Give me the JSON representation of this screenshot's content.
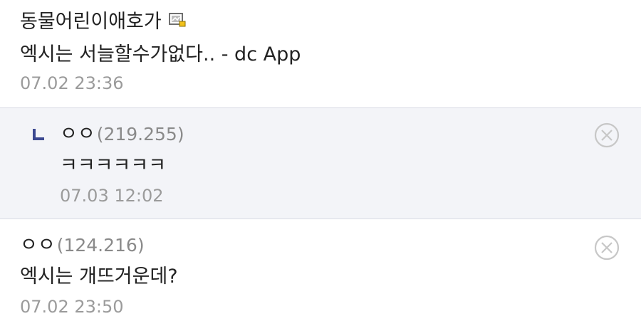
{
  "post_comment": {
    "author": "동물어린이애호가",
    "text": "엑시는 서늘할수가없다.. - dc App",
    "date": "07.02 23:36",
    "nick_icon": "gallery-nick-icon"
  },
  "reply": {
    "author": "ㅇㅇ",
    "ip": "(219.255)",
    "text": "ㅋㅋㅋㅋㅋㅋ",
    "date": "07.03 12:02",
    "reply_icon": "reply-arrow-icon",
    "delete_icon": "close-circle-icon"
  },
  "comment2": {
    "author": "ㅇㅇ",
    "ip": "(124.216)",
    "text": "엑시는 개뜨거운데?",
    "date": "07.02 23:50",
    "delete_icon": "close-circle-icon"
  },
  "colors": {
    "reply_background": "#f3f4f8",
    "divider": "#d7dae3",
    "reply_arrow": "#3b4890",
    "muted_text": "#9b9b9b"
  }
}
